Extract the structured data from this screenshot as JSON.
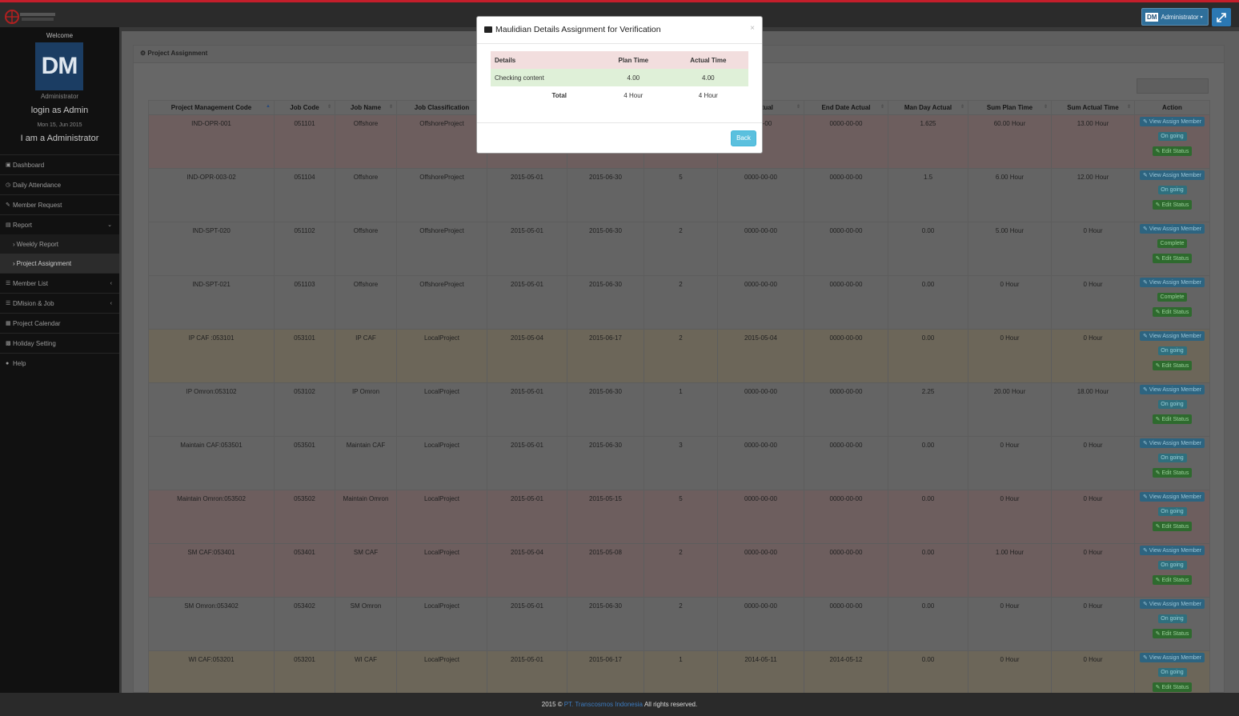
{
  "app": {
    "logo_text": "trans cosmos"
  },
  "topbar": {
    "user_initials": "DM",
    "user_menu_label": "Administrator"
  },
  "sidebar": {
    "welcome": "Welcome",
    "avatar_initials": "DM",
    "role": "Administrator",
    "login_text": "login as Admin",
    "date": "Mon 15, Jun 2015",
    "iam_text": "I am a Administrator",
    "items": [
      {
        "label": "Dashboard",
        "icon": "dashboard-icon"
      },
      {
        "label": "Daily Attendance",
        "icon": "clock-icon"
      },
      {
        "label": "Member Request",
        "icon": "wrench-icon"
      },
      {
        "label": "Report",
        "icon": "file-icon"
      },
      {
        "label": "Weekly Report"
      },
      {
        "label": "Project Assignment"
      },
      {
        "label": "Member List",
        "icon": "list-icon"
      },
      {
        "label": "DMision & Job",
        "icon": "list-icon"
      },
      {
        "label": "Project Calendar",
        "icon": "calendar-icon"
      },
      {
        "label": "Holiday Setting",
        "icon": "holiday-icon"
      },
      {
        "label": "Help",
        "icon": "help-icon"
      }
    ]
  },
  "panel": {
    "title": "Project Assignment"
  },
  "table": {
    "columns": [
      "Project Management Code",
      "Job Code",
      "Job Name",
      "Job Classification",
      "",
      "",
      "",
      "e Actual",
      "End Date Actual",
      "Man Day Actual",
      "Sum Plan Time",
      "Sum Actual Time",
      "Action"
    ],
    "action_labels": {
      "view": "View Assign Member",
      "edit": "Edit Status"
    },
    "rows": [
      {
        "tone": "red",
        "code": "IND-OPR-001",
        "job_code": "051101",
        "job_name": "Offshore",
        "class": "OffshoreProject",
        "start": "",
        "end": "",
        "md": "",
        "sda": "0-00-00",
        "eda": "0000-00-00",
        "mda": "1.625",
        "spt": "60.00 Hour",
        "sat": "13.00 Hour",
        "status": "On going"
      },
      {
        "tone": "gray",
        "code": "IND-OPR-003-02",
        "job_code": "051104",
        "job_name": "Offshore",
        "class": "OffshoreProject",
        "start": "2015-05-01",
        "end": "2015-06-30",
        "md": "5",
        "sda": "0000-00-00",
        "eda": "0000-00-00",
        "mda": "1.5",
        "spt": "6.00 Hour",
        "sat": "12.00 Hour",
        "status": "On going"
      },
      {
        "tone": "gray",
        "code": "IND-SPT-020",
        "job_code": "051102",
        "job_name": "Offshore",
        "class": "OffshoreProject",
        "start": "2015-05-01",
        "end": "2015-06-30",
        "md": "2",
        "sda": "0000-00-00",
        "eda": "0000-00-00",
        "mda": "0.00",
        "spt": "5.00 Hour",
        "sat": "0 Hour",
        "status": "Complete"
      },
      {
        "tone": "gray",
        "code": "IND-SPT-021",
        "job_code": "051103",
        "job_name": "Offshore",
        "class": "OffshoreProject",
        "start": "2015-05-01",
        "end": "2015-06-30",
        "md": "2",
        "sda": "0000-00-00",
        "eda": "0000-00-00",
        "mda": "0.00",
        "spt": "0 Hour",
        "sat": "0 Hour",
        "status": "Complete"
      },
      {
        "tone": "tan",
        "code": "IP CAF :053101",
        "job_code": "053101",
        "job_name": "IP CAF",
        "class": "LocalProject",
        "start": "2015-05-04",
        "end": "2015-06-17",
        "md": "2",
        "sda": "2015-05-04",
        "eda": "0000-00-00",
        "mda": "0.00",
        "spt": "0 Hour",
        "sat": "0 Hour",
        "status": "On going"
      },
      {
        "tone": "gray",
        "code": "IP Omron:053102",
        "job_code": "053102",
        "job_name": "IP Omron",
        "class": "LocalProject",
        "start": "2015-05-01",
        "end": "2015-06-30",
        "md": "1",
        "sda": "0000-00-00",
        "eda": "0000-00-00",
        "mda": "2.25",
        "spt": "20.00 Hour",
        "sat": "18.00 Hour",
        "status": "On going"
      },
      {
        "tone": "gray",
        "code": "Maintain CAF:053501",
        "job_code": "053501",
        "job_name": "Maintain CAF",
        "class": "LocalProject",
        "start": "2015-05-01",
        "end": "2015-06-30",
        "md": "3",
        "sda": "0000-00-00",
        "eda": "0000-00-00",
        "mda": "0.00",
        "spt": "0 Hour",
        "sat": "0 Hour",
        "status": "On going"
      },
      {
        "tone": "red",
        "code": "Maintain Omron:053502",
        "job_code": "053502",
        "job_name": "Maintain Omron",
        "class": "LocalProject",
        "start": "2015-05-01",
        "end": "2015-05-15",
        "md": "5",
        "sda": "0000-00-00",
        "eda": "0000-00-00",
        "mda": "0.00",
        "spt": "0 Hour",
        "sat": "0 Hour",
        "status": "On going"
      },
      {
        "tone": "red",
        "code": "SM CAF:053401",
        "job_code": "053401",
        "job_name": "SM CAF",
        "class": "LocalProject",
        "start": "2015-05-04",
        "end": "2015-05-08",
        "md": "2",
        "sda": "0000-00-00",
        "eda": "0000-00-00",
        "mda": "0.00",
        "spt": "1.00 Hour",
        "sat": "0 Hour",
        "status": "On going"
      },
      {
        "tone": "gray",
        "code": "SM Omron:053402",
        "job_code": "053402",
        "job_name": "SM Omron",
        "class": "LocalProject",
        "start": "2015-05-01",
        "end": "2015-06-30",
        "md": "2",
        "sda": "0000-00-00",
        "eda": "0000-00-00",
        "mda": "0.00",
        "spt": "0 Hour",
        "sat": "0 Hour",
        "status": "On going"
      },
      {
        "tone": "tan",
        "code": "WI CAF:053201",
        "job_code": "053201",
        "job_name": "WI CAF",
        "class": "LocalProject",
        "start": "2015-05-01",
        "end": "2015-06-17",
        "md": "1",
        "sda": "2014-05-11",
        "eda": "2014-05-12",
        "mda": "0.00",
        "spt": "0 Hour",
        "sat": "0 Hour",
        "status": "On going"
      }
    ]
  },
  "modal": {
    "title": "Maulidian Details Assignment for Verification",
    "close": "×",
    "headers": [
      "Details",
      "Plan Time",
      "Actual Time"
    ],
    "rows": [
      {
        "detail": "Checking content",
        "plan": "4.00",
        "actual": "4.00"
      }
    ],
    "total_label": "Total",
    "total_plan": "4 Hour",
    "total_actual": "4 Hour",
    "back_label": "Back"
  },
  "footer": {
    "prefix": "2015 ©",
    "company": "PT. Transcosmos Indonesia",
    "suffix": "All rights reserved."
  },
  "colors": {
    "accent": "#c41e2b",
    "brand_blue": "#2b78b3",
    "modal_header_bg": "#f2dede",
    "modal_row_bg": "#dff0d8"
  }
}
